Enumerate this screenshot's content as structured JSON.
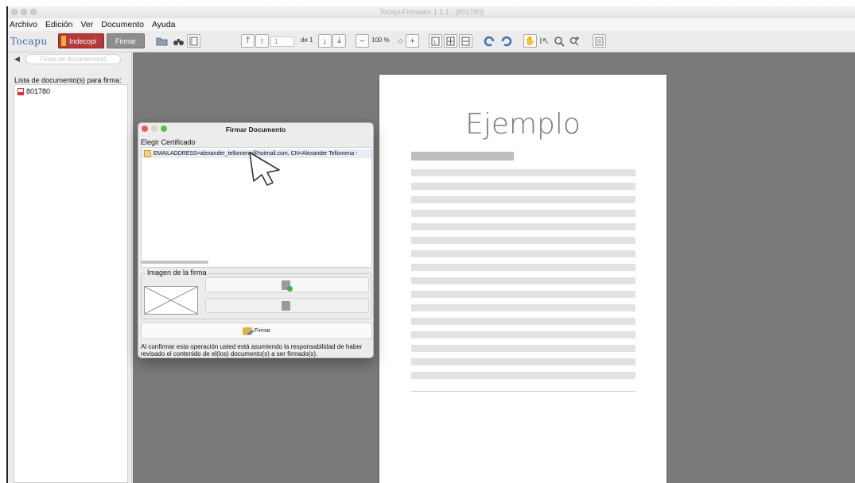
{
  "window": {
    "title": "TocapuFirmador 1.1.1 - [801780]"
  },
  "menu": [
    "Archivo",
    "Edición",
    "Ver",
    "Documento",
    "Ayuda"
  ],
  "toolbar": {
    "logo": "Tocapu",
    "indecopi_label": "Indecopi",
    "firmar_label": "Firmar",
    "page_value": "1",
    "page_total": "de 1",
    "zoom": "100 %"
  },
  "sidebar": {
    "search_placeholder": "Firma de documento(s)",
    "list_label": "Lista de documento(s) para firma:",
    "documents": [
      "801780"
    ]
  },
  "document": {
    "heading": "Ejemplo"
  },
  "dialog": {
    "title": "Firmar Documento",
    "cert_label": "Elegir Certificado",
    "certificate": "EMAILADDRESS=alexander_tellomena@hotmail.com, CN=Alexander Tellomena -",
    "image_legend": "Imagen de la firma",
    "sign_button": "Firmar",
    "notice": "Al confirmar esta operación usted está asumiendo la responsabilidad de haber revisado el contenido de el(los) documento(s) a ser firmado(s)."
  }
}
